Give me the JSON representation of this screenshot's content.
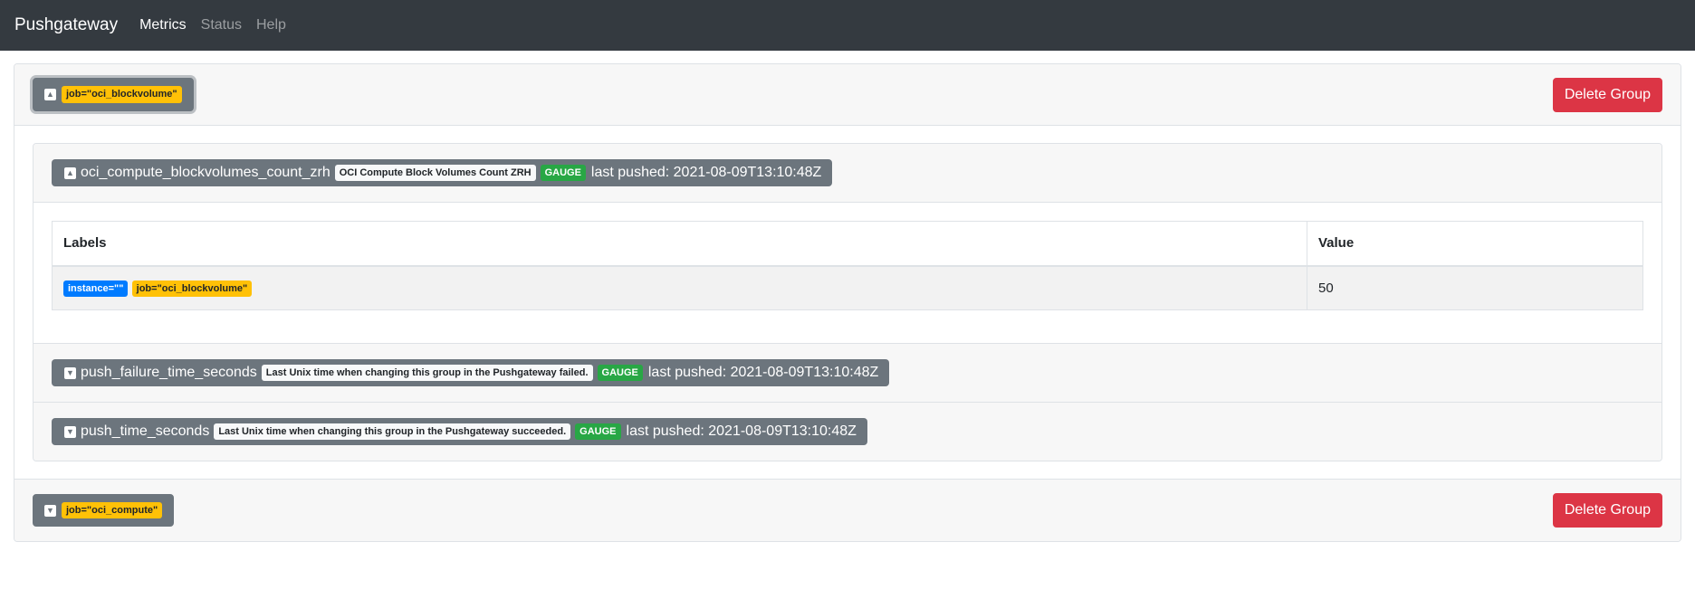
{
  "navbar": {
    "brand": "Pushgateway",
    "links": [
      {
        "label": "Metrics",
        "active": true
      },
      {
        "label": "Status",
        "active": false
      },
      {
        "label": "Help",
        "active": false
      }
    ]
  },
  "groups": [
    {
      "job_label": "job=\"oci_blockvolume\"",
      "delete_label": "Delete Group",
      "expanded": true,
      "metrics": [
        {
          "name": "oci_compute_blockvolumes_count_zrh",
          "help": "OCI Compute Block Volumes Count ZRH",
          "type": "GAUGE",
          "last_pushed": "last pushed: 2021-08-09T13:10:48Z",
          "expanded": true,
          "table": {
            "headers": [
              "Labels",
              "Value"
            ],
            "rows": [
              {
                "labels": [
                  "instance=\"\"",
                  "job=\"oci_blockvolume\""
                ],
                "value": "50"
              }
            ]
          }
        },
        {
          "name": "push_failure_time_seconds",
          "help": "Last Unix time when changing this group in the Pushgateway failed.",
          "type": "GAUGE",
          "last_pushed": "last pushed: 2021-08-09T13:10:48Z",
          "expanded": false
        },
        {
          "name": "push_time_seconds",
          "help": "Last Unix time when changing this group in the Pushgateway succeeded.",
          "type": "GAUGE",
          "last_pushed": "last pushed: 2021-08-09T13:10:48Z",
          "expanded": false
        }
      ]
    },
    {
      "job_label": "job=\"oci_compute\"",
      "delete_label": "Delete Group",
      "expanded": false
    }
  ],
  "icons": {
    "collapse": "caret-up-square-icon",
    "expand": "caret-down-square-icon"
  },
  "colors": {
    "navbar": "#343a40",
    "danger": "#dc3545",
    "warning": "#ffc107",
    "primary": "#007bff",
    "success": "#28a745",
    "secondary": "#6c757d"
  }
}
